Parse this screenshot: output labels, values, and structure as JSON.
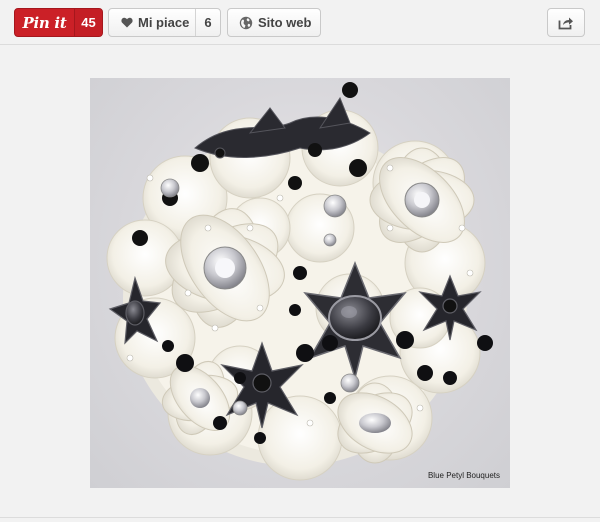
{
  "toolbar": {
    "pin_label": "Pin it",
    "pin_count": "45",
    "like_label": "Mi piace",
    "like_count": "6",
    "website_label": "Sito web",
    "share_icon": "share-icon"
  },
  "photo": {
    "credit": "Blue Petyl Bouquets"
  },
  "colors": {
    "pin_red": "#cb2027",
    "toolbar_bg": "#f2f2f2",
    "photo_bg": "#d9d8dc"
  }
}
